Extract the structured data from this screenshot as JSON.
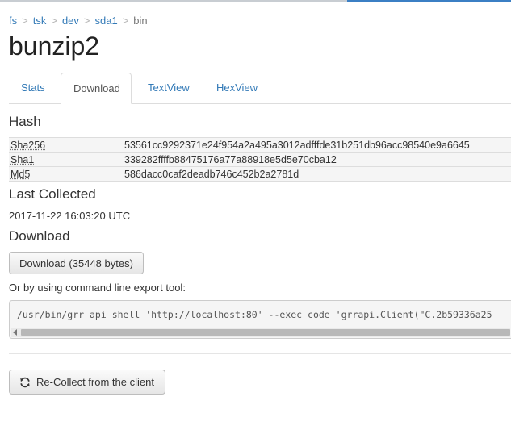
{
  "breadcrumb": {
    "items": [
      {
        "label": "fs"
      },
      {
        "label": "tsk"
      },
      {
        "label": "dev"
      },
      {
        "label": "sda1"
      }
    ],
    "current": "bin",
    "separator": ">"
  },
  "title": "bunzip2",
  "tabs": [
    {
      "label": "Stats",
      "active": false
    },
    {
      "label": "Download",
      "active": true
    },
    {
      "label": "TextView",
      "active": false
    },
    {
      "label": "HexView",
      "active": false
    }
  ],
  "hash": {
    "heading": "Hash",
    "rows": [
      {
        "key": "Sha256",
        "value": "53561cc9292371e24f954a2a495a3012adfffde31b251db96acc98540e9a6645"
      },
      {
        "key": "Sha1",
        "value": "339282ffffb88475176a77a88918e5d5e70cba12"
      },
      {
        "key": "Md5",
        "value": "586dacc0caf2deadb746c452b2a2781d"
      }
    ]
  },
  "last_collected": {
    "heading": "Last Collected",
    "timestamp": "2017-11-22 16:03:20 UTC"
  },
  "download": {
    "heading": "Download",
    "button_label": "Download (35448 bytes)",
    "cli_label": "Or by using command line export tool:",
    "command": "/usr/bin/grr_api_shell 'http://localhost:80' --exec_code 'grrapi.Client(\"C.2b59336a25"
  },
  "recollect": {
    "button_label": "Re-Collect from the client",
    "icon": "refresh-icon"
  },
  "colors": {
    "link": "#337ab7",
    "accent": "#3b7fc4"
  }
}
